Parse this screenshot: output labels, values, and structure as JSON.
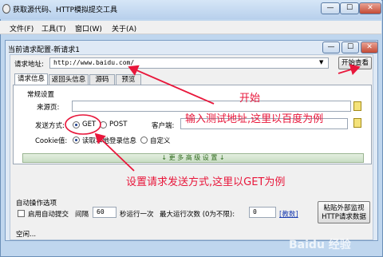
{
  "window": {
    "title": "获取源代码、HTTP模拟提交工具",
    "min": "—",
    "max": "☐",
    "close": "✕"
  },
  "menu": [
    "文件(F)",
    "工具(T)",
    "窗口(W)",
    "关于(A)"
  ],
  "inner": {
    "title": "当前请求配置-新请求1",
    "min": "—",
    "max": "☐",
    "close": "✕"
  },
  "request": {
    "label": "请求地址:",
    "url": "http://www.baidu.com/",
    "start_button": "开始查看"
  },
  "tabs": [
    "请求信息",
    "返回头信息",
    "源码",
    "预览"
  ],
  "panel": {
    "group_label": "常规设置",
    "source_label": "来源页:",
    "method_label": "发送方式:",
    "method_get": "GET",
    "method_post": "POST",
    "client_label": "客户端:",
    "cookie_label": "Cookie值:",
    "cookie_local": "读取本地登录信息",
    "cookie_custom": "自定义",
    "more_settings": "↓ 更 多 高 级 设 置 ↓"
  },
  "auto": {
    "group_label": "自动操作选项",
    "enable_label": "启用自动提交",
    "interval_label": "间隔",
    "interval_value": "60",
    "interval_suffix": "秒运行一次",
    "max_label": "最大运行次数 (0为不限):",
    "max_value": "0",
    "help_link": "[教数]",
    "paste_button": "粘贴外部监视\nHTTP请求数据"
  },
  "status": "空闲...",
  "annotations": {
    "start": "开始",
    "input_url": "输入测试地址,这里以百度为例",
    "set_method": "设置请求发送方式,这里以GET为例"
  },
  "watermark": "Baidu 经验"
}
